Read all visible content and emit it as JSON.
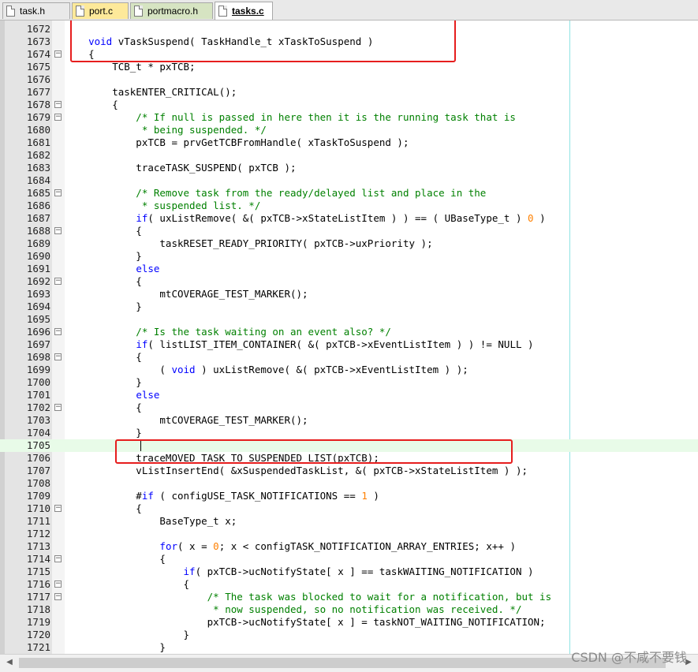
{
  "tabs": [
    {
      "label": "task.h",
      "color": "plain"
    },
    {
      "label": "port.c",
      "color": "yellow"
    },
    {
      "label": "portmacro.h",
      "color": "green"
    },
    {
      "label": "tasks.c",
      "color": "active"
    }
  ],
  "lines": [
    {
      "n": "1672",
      "text": ""
    },
    {
      "n": "1673",
      "text": "    void vTaskSuspend( TaskHandle_t xTaskToSuspend )"
    },
    {
      "n": "1674",
      "text": "    {"
    },
    {
      "n": "1675",
      "text": "        TCB_t * pxTCB;"
    },
    {
      "n": "1676",
      "text": ""
    },
    {
      "n": "1677",
      "text": "        taskENTER_CRITICAL();"
    },
    {
      "n": "1678",
      "text": "        {"
    },
    {
      "n": "1679",
      "text": "            /* If null is passed in here then it is the running task that is"
    },
    {
      "n": "1680",
      "text": "             * being suspended. */"
    },
    {
      "n": "1681",
      "text": "            pxTCB = prvGetTCBFromHandle( xTaskToSuspend );"
    },
    {
      "n": "1682",
      "text": ""
    },
    {
      "n": "1683",
      "text": "            traceTASK_SUSPEND( pxTCB );"
    },
    {
      "n": "1684",
      "text": ""
    },
    {
      "n": "1685",
      "text": "            /* Remove task from the ready/delayed list and place in the"
    },
    {
      "n": "1686",
      "text": "             * suspended list. */"
    },
    {
      "n": "1687",
      "text": "            if( uxListRemove( &( pxTCB->xStateListItem ) ) == ( UBaseType_t ) 0 )"
    },
    {
      "n": "1688",
      "text": "            {"
    },
    {
      "n": "1689",
      "text": "                taskRESET_READY_PRIORITY( pxTCB->uxPriority );"
    },
    {
      "n": "1690",
      "text": "            }"
    },
    {
      "n": "1691",
      "text": "            else"
    },
    {
      "n": "1692",
      "text": "            {"
    },
    {
      "n": "1693",
      "text": "                mtCOVERAGE_TEST_MARKER();"
    },
    {
      "n": "1694",
      "text": "            }"
    },
    {
      "n": "1695",
      "text": ""
    },
    {
      "n": "1696",
      "text": "            /* Is the task waiting on an event also? */"
    },
    {
      "n": "1697",
      "text": "            if( listLIST_ITEM_CONTAINER( &( pxTCB->xEventListItem ) ) != NULL )"
    },
    {
      "n": "1698",
      "text": "            {"
    },
    {
      "n": "1699",
      "text": "                ( void ) uxListRemove( &( pxTCB->xEventListItem ) );"
    },
    {
      "n": "1700",
      "text": "            }"
    },
    {
      "n": "1701",
      "text": "            else"
    },
    {
      "n": "1702",
      "text": "            {"
    },
    {
      "n": "1703",
      "text": "                mtCOVERAGE_TEST_MARKER();"
    },
    {
      "n": "1704",
      "text": "            }"
    },
    {
      "n": "1705",
      "text": ""
    },
    {
      "n": "1706",
      "text": "            traceMOVED_TASK_TO_SUSPENDED_LIST(pxTCB);"
    },
    {
      "n": "1707",
      "text": "            vListInsertEnd( &xSuspendedTaskList, &( pxTCB->xStateListItem ) );"
    },
    {
      "n": "1708",
      "text": ""
    },
    {
      "n": "1709",
      "text": "            #if ( configUSE_TASK_NOTIFICATIONS == 1 )"
    },
    {
      "n": "1710",
      "text": "            {"
    },
    {
      "n": "1711",
      "text": "                BaseType_t x;"
    },
    {
      "n": "1712",
      "text": ""
    },
    {
      "n": "1713",
      "text": "                for( x = 0; x < configTASK_NOTIFICATION_ARRAY_ENTRIES; x++ )"
    },
    {
      "n": "1714",
      "text": "                {"
    },
    {
      "n": "1715",
      "text": "                    if( pxTCB->ucNotifyState[ x ] == taskWAITING_NOTIFICATION )"
    },
    {
      "n": "1716",
      "text": "                    {"
    },
    {
      "n": "1717",
      "text": "                        /* The task was blocked to wait for a notification, but is"
    },
    {
      "n": "1718",
      "text": "                         * now suspended, so no notification was received. */"
    },
    {
      "n": "1719",
      "text": "                        pxTCB->ucNotifyState[ x ] = taskNOT_WAITING_NOTIFICATION;"
    },
    {
      "n": "1720",
      "text": "                    }"
    },
    {
      "n": "1721",
      "text": "                }"
    }
  ],
  "fold_boxes": [
    "1674",
    "1678",
    "1679",
    "1685",
    "1688",
    "1692",
    "1696",
    "1698",
    "1702",
    "1710",
    "1714",
    "1716",
    "1717"
  ],
  "highlighted_line": "1705",
  "watermark": "CSDN @不咸不要钱",
  "colors": {
    "comment": "#008000",
    "keyword": "#0000ff",
    "number": "#ff8000",
    "annotation": "#e61e1e"
  }
}
